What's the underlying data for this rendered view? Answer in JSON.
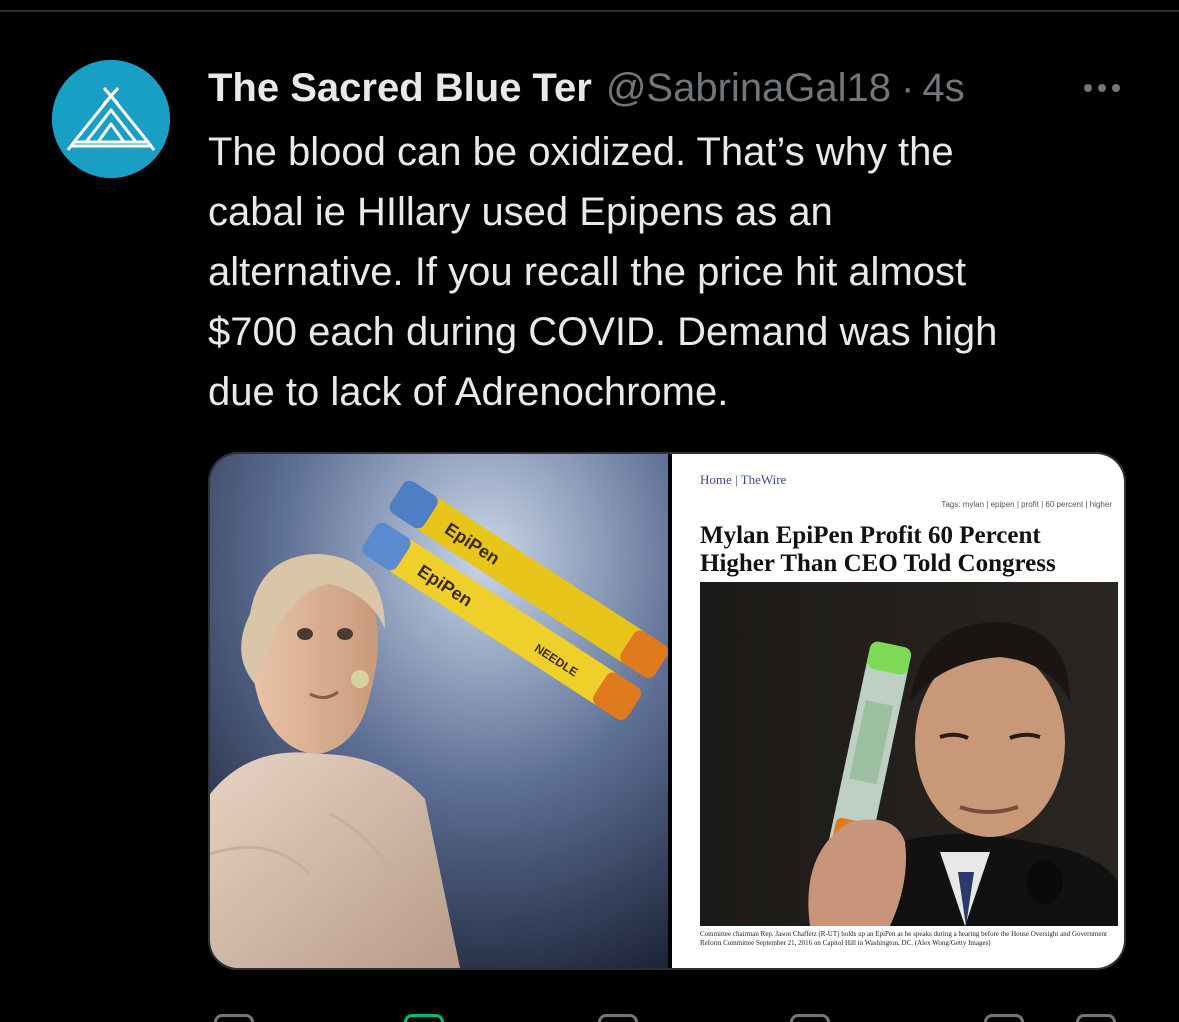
{
  "tweet": {
    "display_name": "The Sacred Blue Ter",
    "handle": "@SabrinaGal18",
    "separator": "·",
    "time": "4s",
    "text": "The blood can be oxidized. That’s why the\ncabal ie HIllary used Epipens as an\nalternative. If you recall the price hit almost\n$700 each during COVID.  Demand was high\ndue to lack of Adrenochrome.",
    "avatar_icon": "tent-icon",
    "avatar_color": "#1a9fc4"
  },
  "media": {
    "left_image": {
      "description_icon": "photo-icon",
      "pen_label_1": "EpiPen",
      "pen_label_2": "EpiPen",
      "pen_side_text": "NEEDLE"
    },
    "right_image": {
      "breadcrumb": "Home | TheWire",
      "tags": "Tags: mylan | epipen | profit | 60 percent | higher",
      "headline": "Mylan EpiPen Profit 60 Percent Higher Than CEO Told Congress",
      "caption": "Committee chairman Rep. Jason Chaffetz (R-UT) holds up an EpiPen as he speaks during a hearing before the House Oversight and Government Reform Committee September 21, 2016 on Capitol Hill in Washington, DC. (Alex Wong/Getty Images)"
    }
  },
  "colors": {
    "background": "#000000",
    "text": "#e7e9ea",
    "secondary": "#71767b",
    "border": "#2f3336",
    "retweet_green": "#00ba7c"
  },
  "actions": [
    "reply-icon",
    "retweet-icon",
    "like-icon",
    "views-icon",
    "bookmark-icon",
    "share-icon"
  ]
}
